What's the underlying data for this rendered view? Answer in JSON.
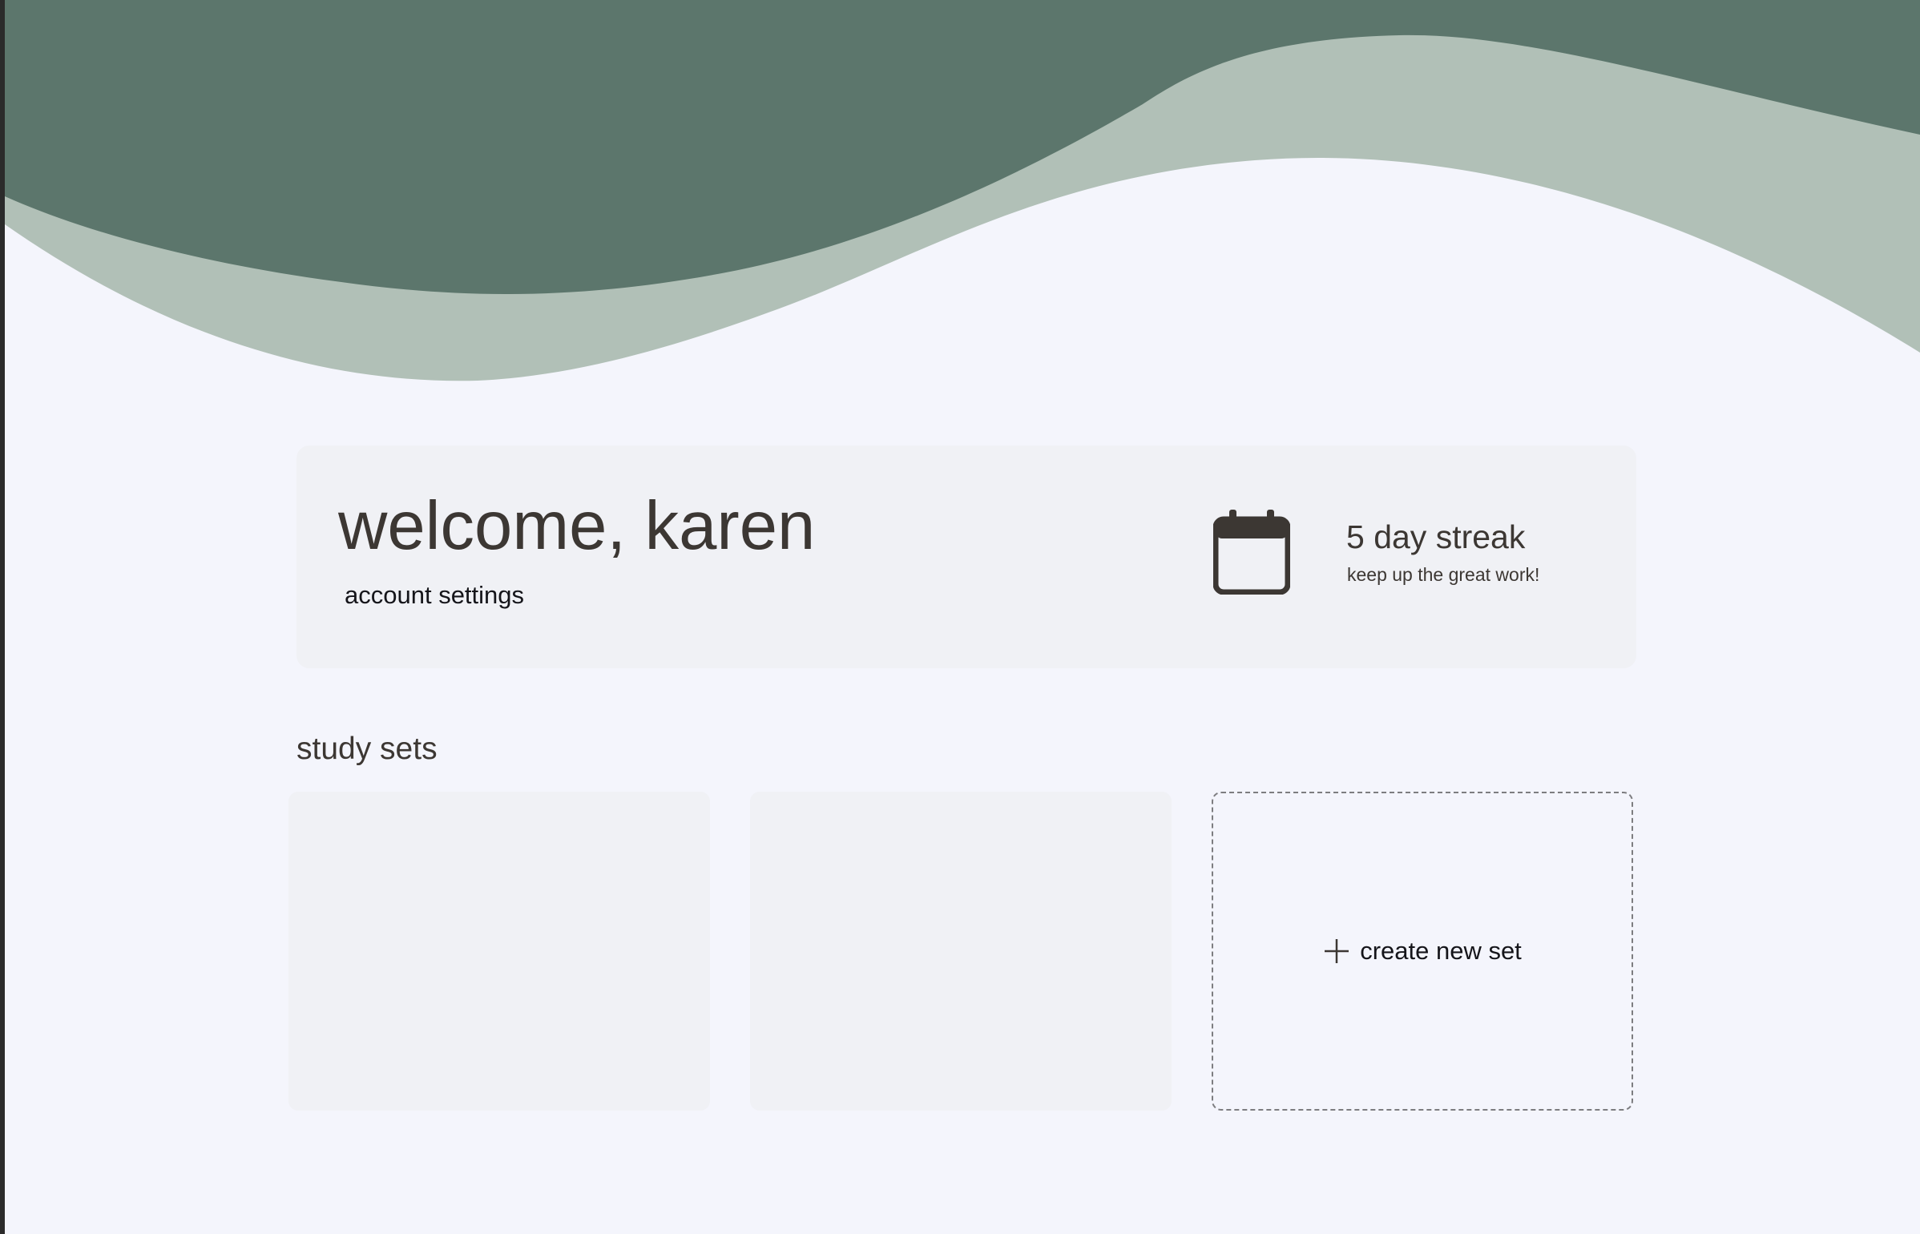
{
  "header": {
    "welcome_title": "welcome, karen",
    "account_settings_label": "account settings"
  },
  "streak": {
    "icon": "calendar-icon",
    "title": "5 day streak",
    "subtitle": "keep up the great work!"
  },
  "study_sets": {
    "section_title": "study sets",
    "cards": [
      {
        "label": ""
      },
      {
        "label": ""
      }
    ],
    "create_label": "create new set",
    "create_icon": "plus-icon"
  },
  "colors": {
    "background": "#f4f5fc",
    "wave_dark": "#5c766c",
    "wave_light": "#b1c0b7",
    "card": "#f0f1f5",
    "text": "#3c3733"
  }
}
